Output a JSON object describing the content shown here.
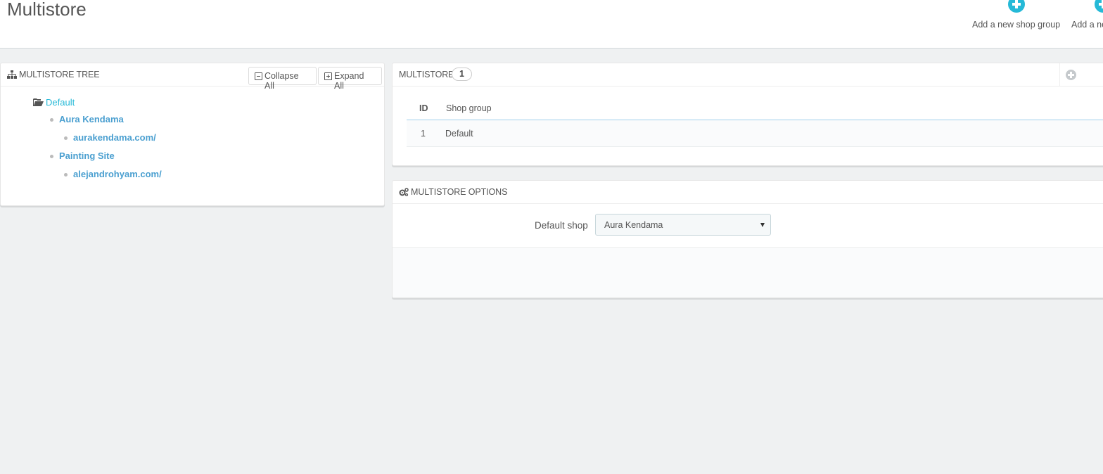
{
  "header": {
    "title": "Multistore",
    "toolbar": {
      "add_shop_group": "Add a new shop group",
      "add_shop": "Add a ne"
    }
  },
  "tree_panel": {
    "title": "MULTISTORE TREE",
    "collapse_label": "Collapse All",
    "expand_label": "Expand All",
    "nodes": {
      "group": "Default",
      "shop1": "Aura Kendama",
      "shop1_url": "aurakendama.com/",
      "shop2": "Painting Site",
      "shop2_url": "alejandrohyam.com/"
    }
  },
  "multistore_panel": {
    "title": "MULTISTORE",
    "count": "1",
    "columns": [
      "ID",
      "Shop group"
    ],
    "rows": [
      {
        "id": "1",
        "shop_group": "Default"
      }
    ]
  },
  "options_panel": {
    "title": "MULTISTORE OPTIONS",
    "default_shop_label": "Default shop",
    "default_shop_value": "Aura Kendama"
  },
  "colors": {
    "accent": "#25b9d7",
    "link_bold": "#4a9fd0",
    "background": "#eff1f2"
  }
}
